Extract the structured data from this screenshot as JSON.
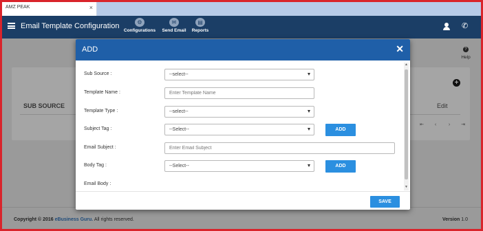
{
  "browser": {
    "tab_title": "AMZ PEAK",
    "tab_close": "×"
  },
  "appbar": {
    "title": "Email Template Configuration",
    "nav": [
      {
        "label": "Configurations",
        "icon": "gear-icon",
        "glyph": "⚙"
      },
      {
        "label": "Send Email",
        "icon": "envelope-icon",
        "glyph": "✉"
      },
      {
        "label": "Reports",
        "icon": "report-icon",
        "glyph": "▤"
      }
    ],
    "phone_glyph": "✆"
  },
  "page": {
    "help_icon": "?",
    "help_label": "Help",
    "add_glyph": "+",
    "column_sub_source": "SUB SOURCE",
    "column_edit": "Edit",
    "pager": {
      "first": "⇤",
      "prev": "‹",
      "next": "›",
      "last": "⇥"
    }
  },
  "modal": {
    "title": "ADD",
    "close": "✕",
    "sub_source": {
      "label": "Sub Source :",
      "value": "--select--"
    },
    "template_name": {
      "label": "Template Name :",
      "placeholder": "Enter Template Name"
    },
    "template_type": {
      "label": "Template Type :",
      "value": "--select--"
    },
    "subject_tag": {
      "label": "Subject Tag :",
      "value": "--Select--",
      "add_label": "ADD"
    },
    "email_subject": {
      "label": "Email Subject :",
      "placeholder": "Enter Email Subject"
    },
    "body_tag": {
      "label": "Body Tag :",
      "value": "--Select--",
      "add_label": "ADD"
    },
    "email_body": {
      "label": "Email Body :"
    },
    "save_label": "SAVE"
  },
  "footer": {
    "copyright_prefix": "Copyright © 2016",
    "brand": "eBusiness Guru.",
    "copyright_suffix": "All rights reserved.",
    "version_label": "Version",
    "version_value": "1.0"
  }
}
